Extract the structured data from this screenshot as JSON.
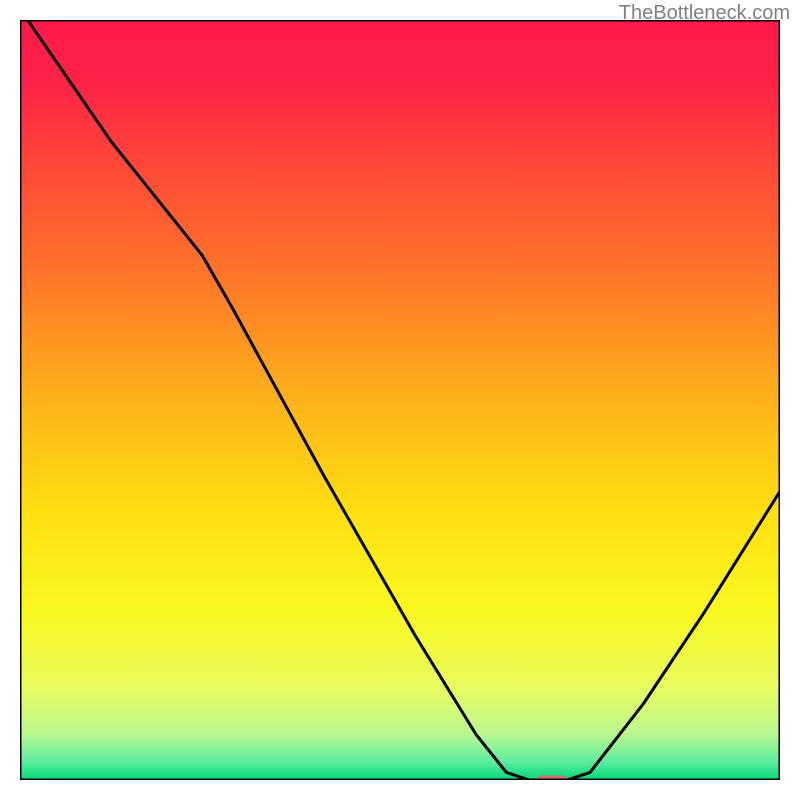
{
  "watermark": "TheBottleneck.com",
  "chart_data": {
    "type": "line",
    "title": "",
    "xlabel": "",
    "ylabel": "",
    "xlim": [
      0,
      100
    ],
    "ylim": [
      0,
      100
    ],
    "background_gradient": {
      "type": "vertical",
      "stops": [
        {
          "offset": 0.0,
          "color": "#ff1a4c"
        },
        {
          "offset": 0.08,
          "color": "#ff2247"
        },
        {
          "offset": 0.2,
          "color": "#ff4a37"
        },
        {
          "offset": 0.35,
          "color": "#ff7a28"
        },
        {
          "offset": 0.5,
          "color": "#ffb21a"
        },
        {
          "offset": 0.65,
          "color": "#ffe010"
        },
        {
          "offset": 0.78,
          "color": "#f9f920"
        },
        {
          "offset": 0.88,
          "color": "#e8fb60"
        },
        {
          "offset": 0.94,
          "color": "#b8f890"
        },
        {
          "offset": 0.975,
          "color": "#60eda0"
        },
        {
          "offset": 1.0,
          "color": "#00d978"
        }
      ]
    },
    "series": [
      {
        "name": "bottleneck-curve",
        "type": "line",
        "color": "#000000",
        "points": [
          {
            "x": 1,
            "y": 100
          },
          {
            "x": 12,
            "y": 84
          },
          {
            "x": 24,
            "y": 69
          },
          {
            "x": 28,
            "y": 62
          },
          {
            "x": 40,
            "y": 40
          },
          {
            "x": 52,
            "y": 19
          },
          {
            "x": 60,
            "y": 6
          },
          {
            "x": 64,
            "y": 1
          },
          {
            "x": 67,
            "y": 0
          },
          {
            "x": 72,
            "y": 0
          },
          {
            "x": 75,
            "y": 1
          },
          {
            "x": 82,
            "y": 10
          },
          {
            "x": 90,
            "y": 22
          },
          {
            "x": 100,
            "y": 38
          }
        ]
      }
    ],
    "marker": {
      "name": "optimal-point",
      "x": 70,
      "y": 0,
      "width": 4,
      "height": 1.2,
      "color": "#d96a72"
    },
    "axes": {
      "show_ticks": false,
      "show_labels": false,
      "border_color": "#000000"
    }
  }
}
